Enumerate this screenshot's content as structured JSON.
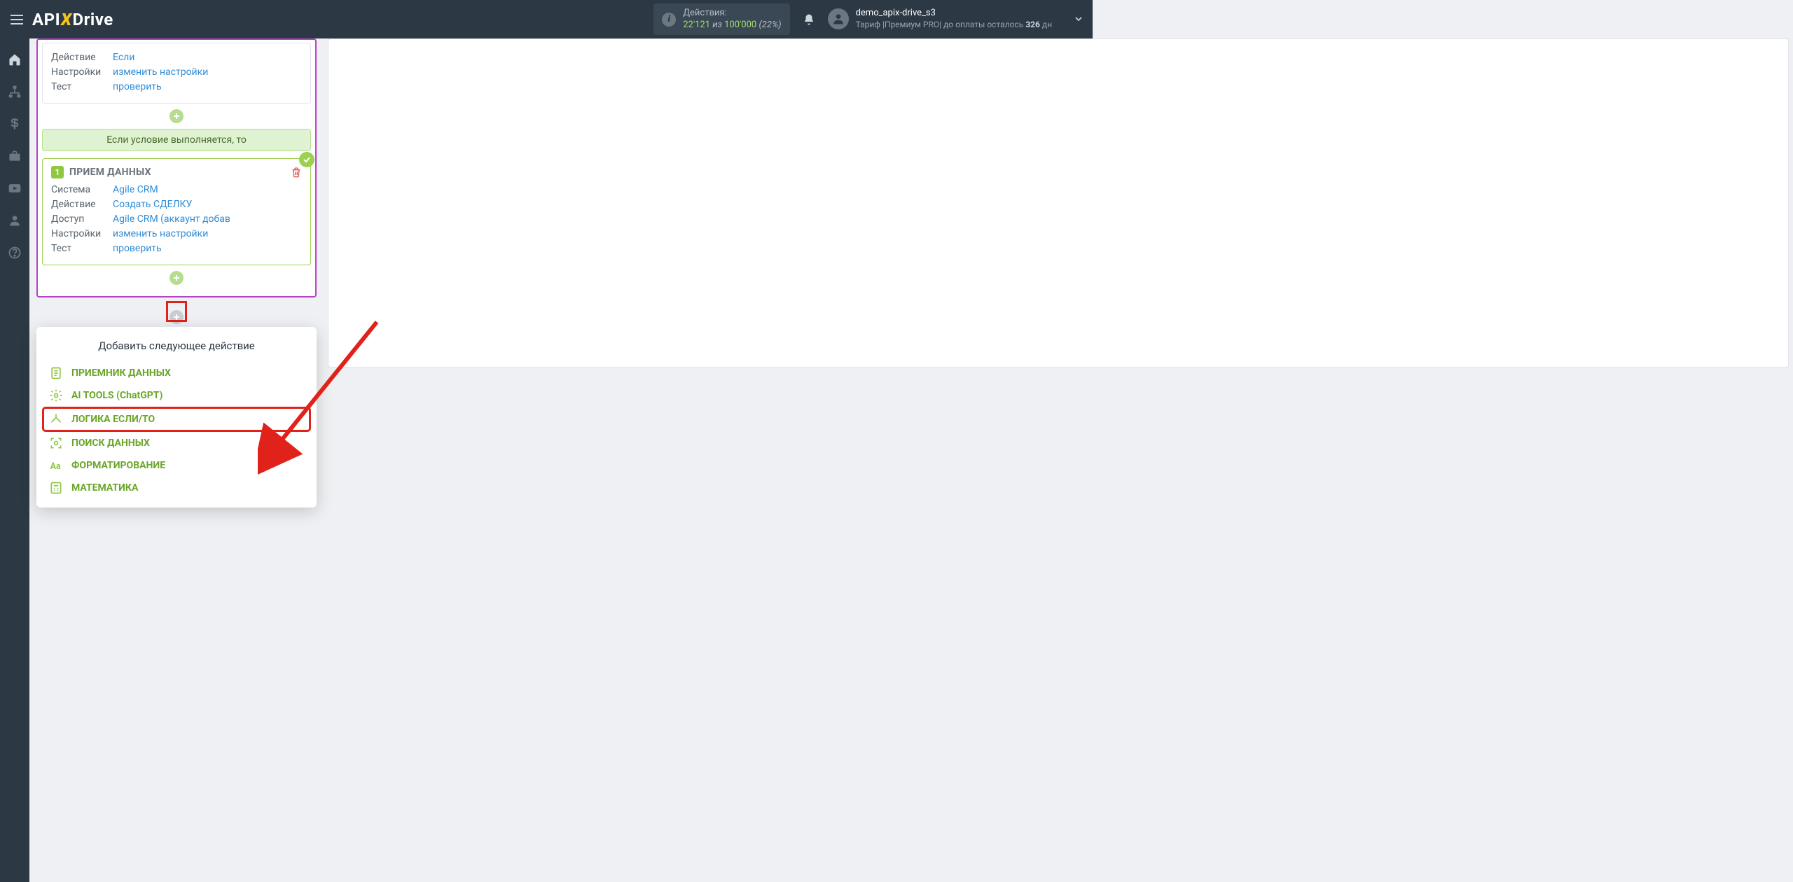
{
  "header": {
    "logo_part1": "API",
    "logo_part2": "X",
    "logo_part3": "Drive",
    "actions_label": "Действия:",
    "actions_used": "22'121",
    "actions_sep": " из ",
    "actions_total": "100'000",
    "actions_pct": "(22%)",
    "user_name": "demo_apix-drive_s3",
    "tariff_prefix": "Тариф |Премиум PRO| до оплаты осталось ",
    "tariff_days": "326",
    "tariff_suffix": " дн"
  },
  "card_if": {
    "r1_lbl": "Действие",
    "r1_val": "Если",
    "r2_lbl": "Настройки",
    "r2_val": "изменить настройки",
    "r3_lbl": "Тест",
    "r3_val": "проверить"
  },
  "cond_text": "Если условие выполняется, то",
  "card_recv": {
    "badge": "1",
    "title": "ПРИЕМ ДАННЫХ",
    "r1_lbl": "Система",
    "r1_val": "Agile CRM",
    "r2_lbl": "Действие",
    "r2_val": "Создать СДЕЛКУ",
    "r3_lbl": "Доступ",
    "r3_val": "Agile CRM (аккаунт добав",
    "r4_lbl": "Настройки",
    "r4_val": "изменить настройки",
    "r5_lbl": "Тест",
    "r5_val": "проверить"
  },
  "popup": {
    "title": "Добавить следующее действие",
    "items": [
      "ПРИЕМНИК ДАННЫХ",
      "AI TOOLS (ChatGPT)",
      "ЛОГИКА ЕСЛИ/ТО",
      "ПОИСК ДАННЫХ",
      "ФОРМАТИРОВАНИЕ",
      "МАТЕМАТИКА"
    ]
  }
}
